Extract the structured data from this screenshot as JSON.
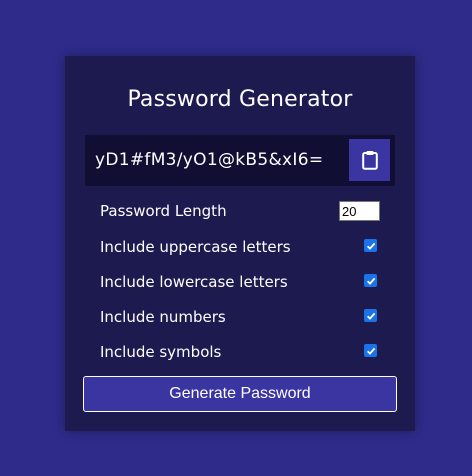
{
  "app": {
    "title": "Password Generator"
  },
  "result": {
    "password": "yD1#fM3/yO1@kB5&xI6="
  },
  "settings": {
    "length_label": "Password Length",
    "length_value": "20",
    "options": [
      {
        "label": "Include uppercase letters",
        "checked": true
      },
      {
        "label": "Include lowercase letters",
        "checked": true
      },
      {
        "label": "Include numbers",
        "checked": true
      },
      {
        "label": "Include symbols",
        "checked": true
      }
    ]
  },
  "actions": {
    "generate_label": "Generate Password",
    "clipboard_icon": "clipboard-icon"
  },
  "colors": {
    "background": "#2e2b8a",
    "card": "#1c1a4f",
    "result_bg": "#100e33",
    "button": "#3a35a0",
    "checkbox": "#1a73e8"
  }
}
